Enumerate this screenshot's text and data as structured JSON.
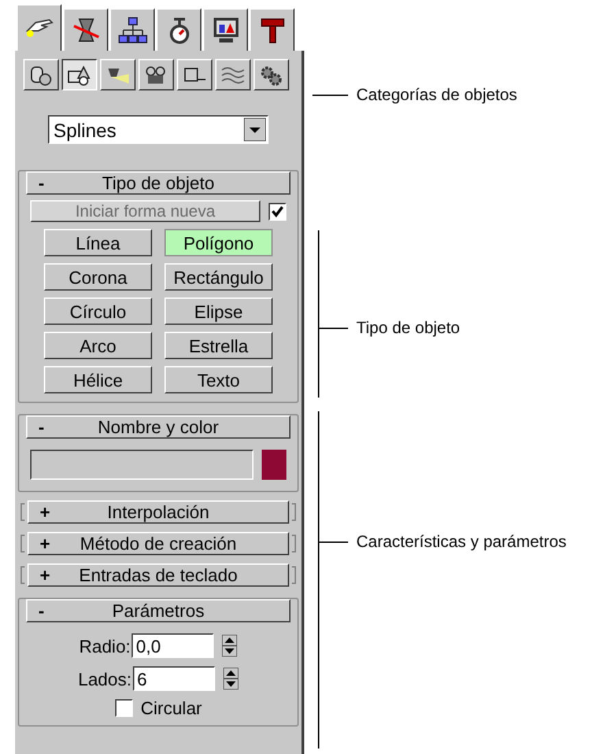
{
  "command_tabs": [
    {
      "kind": "create",
      "selected": true
    },
    {
      "kind": "modify",
      "selected": false
    },
    {
      "kind": "hierarchy",
      "selected": false
    },
    {
      "kind": "motion",
      "selected": false
    },
    {
      "kind": "display",
      "selected": false
    },
    {
      "kind": "utilities",
      "selected": false
    }
  ],
  "categories": [
    {
      "kind": "geometry",
      "selected": false
    },
    {
      "kind": "shapes",
      "selected": true
    },
    {
      "kind": "lights",
      "selected": false
    },
    {
      "kind": "cameras",
      "selected": false
    },
    {
      "kind": "helpers",
      "selected": false
    },
    {
      "kind": "spacewarps",
      "selected": false
    },
    {
      "kind": "systems",
      "selected": false
    }
  ],
  "dropdown": {
    "value": "Splines"
  },
  "rollouts": [
    {
      "kind": "object_type",
      "sign": "-",
      "title": "Tipo de objeto",
      "expanded": true,
      "start_new_shape": {
        "label": "Iniciar forma nueva",
        "disabled": true,
        "checked": true
      },
      "buttons": [
        {
          "label": "Línea",
          "selected": false
        },
        {
          "label": "Polígono",
          "selected": true
        },
        {
          "label": "Corona",
          "selected": false
        },
        {
          "label": "Rectángulo",
          "selected": false
        },
        {
          "label": "Círculo",
          "selected": false
        },
        {
          "label": "Elipse",
          "selected": false
        },
        {
          "label": "Arco",
          "selected": false
        },
        {
          "label": "Estrella",
          "selected": false
        },
        {
          "label": "Hélice",
          "selected": false
        },
        {
          "label": "Texto",
          "selected": false
        }
      ]
    },
    {
      "kind": "name_color",
      "sign": "-",
      "title": "Nombre y color",
      "expanded": true,
      "color": "#8e0a34"
    },
    {
      "sign": "+",
      "title": "Interpolación",
      "expanded": false
    },
    {
      "sign": "+",
      "title": "Método de creación",
      "expanded": false
    },
    {
      "sign": "+",
      "title": "Entradas de teclado",
      "expanded": false
    },
    {
      "kind": "parameters",
      "sign": "-",
      "title": "Parámetros",
      "expanded": true,
      "fields": [
        {
          "label": "Radio:",
          "value": "0,0"
        },
        {
          "label": "Lados:",
          "value": "6"
        }
      ],
      "checkbox": {
        "label": "Circular",
        "checked": false
      }
    }
  ],
  "annotations": [
    {
      "kind": "pointer",
      "text": "Categorías de objetos"
    },
    {
      "kind": "bracket",
      "text": "Tipo de objeto"
    },
    {
      "kind": "bracket",
      "text": "Características y parámetros"
    }
  ]
}
